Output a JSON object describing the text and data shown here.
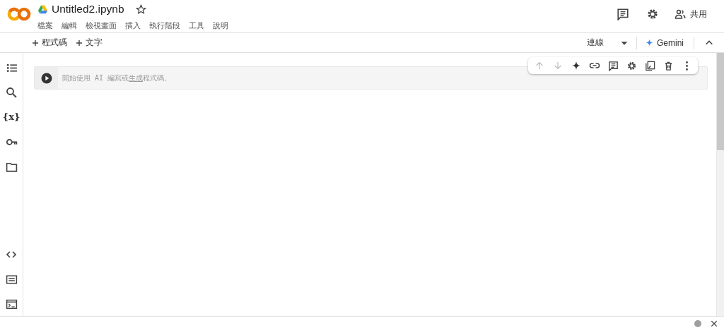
{
  "title": "Untitled2.ipynb",
  "starred": false,
  "menu": [
    "檔案",
    "編輯",
    "檢視畫面",
    "插入",
    "執行階段",
    "工具",
    "說明"
  ],
  "share": "共用",
  "add_buttons": [
    "程式碼",
    "文字"
  ],
  "connection": "連線",
  "gemini": "Gemini",
  "variables_label": "{x}",
  "cell": {
    "text_before": "開始使用 AI 編寫或",
    "link": "生成",
    "text_after": "程式碼。"
  },
  "cell_toolbar": {
    "move_up_disabled": true,
    "move_down_disabled": true
  }
}
